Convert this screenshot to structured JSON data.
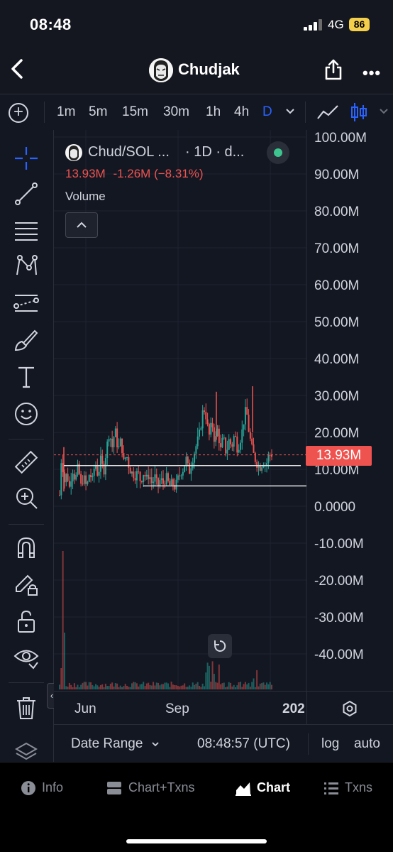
{
  "status": {
    "time": "08:48",
    "network": "4G",
    "battery": "86"
  },
  "header": {
    "title": "Chudjak"
  },
  "toolbar": {
    "timeframes": [
      "1m",
      "5m",
      "15m",
      "30m",
      "1h",
      "4h",
      "D"
    ],
    "active_timeframe": "D"
  },
  "legend": {
    "symbol": "Chud/SOL ...",
    "interval": "· 1D · d...",
    "last_value": "13.93M",
    "change": "-1.26M",
    "change_pct": "(−8.31%)",
    "study": "Volume"
  },
  "price_label": "13.93M",
  "chart_data": {
    "type": "candlestick",
    "y_ticks": [
      "100.00M",
      "90.00M",
      "80.00M",
      "70.00M",
      "60.00M",
      "50.00M",
      "40.00M",
      "30.00M",
      "20.00M",
      "10.00M",
      "0.0000",
      "-10.00M",
      "-20.00M",
      "-30.00M",
      "-40.00M"
    ],
    "x_ticks": [
      "Jun",
      "Sep",
      "202"
    ],
    "ylim": [
      -50000000,
      100000000
    ],
    "last_price": 13930000,
    "horizontal_lines": [
      11000000,
      5500000
    ],
    "candle_close_path": [
      [
        0,
        3000000
      ],
      [
        3,
        15000000
      ],
      [
        6,
        6000000
      ],
      [
        10,
        9000000
      ],
      [
        14,
        5000000
      ],
      [
        18,
        10000000
      ],
      [
        22,
        7000000
      ],
      [
        26,
        11000000
      ],
      [
        30,
        5500000
      ],
      [
        34,
        8000000
      ],
      [
        38,
        5000000
      ],
      [
        42,
        9000000
      ],
      [
        46,
        7000000
      ],
      [
        50,
        12000000
      ],
      [
        54,
        8000000
      ],
      [
        58,
        13000000
      ],
      [
        62,
        9000000
      ],
      [
        66,
        16000000
      ],
      [
        70,
        20000000
      ],
      [
        74,
        16000000
      ],
      [
        78,
        21000000
      ],
      [
        82,
        15000000
      ],
      [
        86,
        18000000
      ],
      [
        90,
        12000000
      ],
      [
        94,
        14000000
      ],
      [
        98,
        10000000
      ],
      [
        102,
        9000000
      ],
      [
        106,
        8000000
      ],
      [
        110,
        9500000
      ],
      [
        114,
        6500000
      ],
      [
        118,
        9000000
      ],
      [
        122,
        7500000
      ],
      [
        126,
        8500000
      ],
      [
        130,
        6000000
      ],
      [
        134,
        8000000
      ],
      [
        138,
        5500000
      ],
      [
        142,
        7500000
      ],
      [
        146,
        6000000
      ],
      [
        150,
        8000000
      ],
      [
        154,
        5500000
      ],
      [
        158,
        6500000
      ],
      [
        162,
        5000000
      ],
      [
        166,
        7500000
      ],
      [
        170,
        9000000
      ],
      [
        174,
        10000000
      ],
      [
        178,
        13000000
      ],
      [
        182,
        9000000
      ],
      [
        186,
        12000000
      ],
      [
        190,
        15000000
      ],
      [
        194,
        18000000
      ],
      [
        198,
        21000000
      ],
      [
        202,
        27000000
      ],
      [
        206,
        24000000
      ],
      [
        210,
        19000000
      ],
      [
        214,
        23000000
      ],
      [
        218,
        17000000
      ],
      [
        222,
        21000000
      ],
      [
        226,
        15000000
      ],
      [
        230,
        19000000
      ],
      [
        234,
        14000000
      ],
      [
        238,
        18000000
      ],
      [
        242,
        16000000
      ],
      [
        246,
        20000000
      ],
      [
        250,
        15000000
      ],
      [
        254,
        18000000
      ],
      [
        258,
        22000000
      ],
      [
        262,
        27000000
      ],
      [
        266,
        20000000
      ],
      [
        270,
        16000000
      ],
      [
        274,
        13000000
      ],
      [
        278,
        11000000
      ],
      [
        282,
        10500000
      ],
      [
        286,
        12000000
      ],
      [
        290,
        11000000
      ],
      [
        294,
        14000000
      ],
      [
        298,
        13930000
      ]
    ],
    "volume_peak_index": 2
  },
  "date_range": {
    "label": "Date Range",
    "time": "08:48:57 (UTC)",
    "log": "log",
    "auto": "auto"
  },
  "tabs": [
    {
      "label": "Info"
    },
    {
      "label": "Chart+Txns"
    },
    {
      "label": "Chart"
    },
    {
      "label": "Txns"
    }
  ],
  "colors": {
    "up": "#26a69a",
    "down": "#ef5350",
    "accent": "#2962ff",
    "bg": "#131722"
  }
}
